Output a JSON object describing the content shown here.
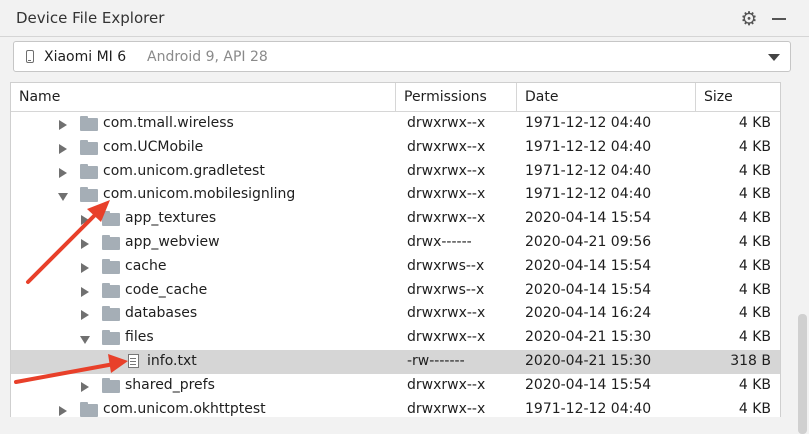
{
  "panel": {
    "title": "Device File Explorer",
    "settings_icon": "gear-icon",
    "hide_icon": "minimize-icon"
  },
  "device": {
    "name": "Xiaomi MI 6",
    "details": "Android 9, API 28"
  },
  "columns": {
    "name": "Name",
    "permissions": "Permissions",
    "date": "Date",
    "size": "Size"
  },
  "rows": [
    {
      "name": "com.tmall.wireless",
      "perm": "drwxrwx--x",
      "date": "1971-12-12 04:40",
      "size": "4 KB"
    },
    {
      "name": "com.UCMobile",
      "perm": "drwxrwx--x",
      "date": "1971-12-12 04:40",
      "size": "4 KB"
    },
    {
      "name": "com.unicom.gradletest",
      "perm": "drwxrwx--x",
      "date": "1971-12-12 04:40",
      "size": "4 KB"
    },
    {
      "name": "com.unicom.mobilesignling",
      "perm": "drwxrwx--x",
      "date": "1971-12-12 04:40",
      "size": "4 KB"
    },
    {
      "name": "app_textures",
      "perm": "drwxrwx--x",
      "date": "2020-04-14 15:54",
      "size": "4 KB"
    },
    {
      "name": "app_webview",
      "perm": "drwx------",
      "date": "2020-04-21 09:56",
      "size": "4 KB"
    },
    {
      "name": "cache",
      "perm": "drwxrws--x",
      "date": "2020-04-14 15:54",
      "size": "4 KB"
    },
    {
      "name": "code_cache",
      "perm": "drwxrws--x",
      "date": "2020-04-14 15:54",
      "size": "4 KB"
    },
    {
      "name": "databases",
      "perm": "drwxrwx--x",
      "date": "2020-04-14 16:24",
      "size": "4 KB"
    },
    {
      "name": "files",
      "perm": "drwxrwx--x",
      "date": "2020-04-21 15:30",
      "size": "4 KB"
    },
    {
      "name": "info.txt",
      "perm": "-rw-------",
      "date": "2020-04-21 15:30",
      "size": "318 B"
    },
    {
      "name": "shared_prefs",
      "perm": "drwxrwx--x",
      "date": "2020-04-14 15:54",
      "size": "4 KB"
    },
    {
      "name": "com.unicom.okhttptest",
      "perm": "drwxrwx--x",
      "date": "1971-12-12 04:40",
      "size": "4 KB"
    }
  ],
  "colors": {
    "selected_row": "#d6d6d6",
    "annotation_arrow": "#e8402a",
    "folder": "#a5aeb6"
  }
}
